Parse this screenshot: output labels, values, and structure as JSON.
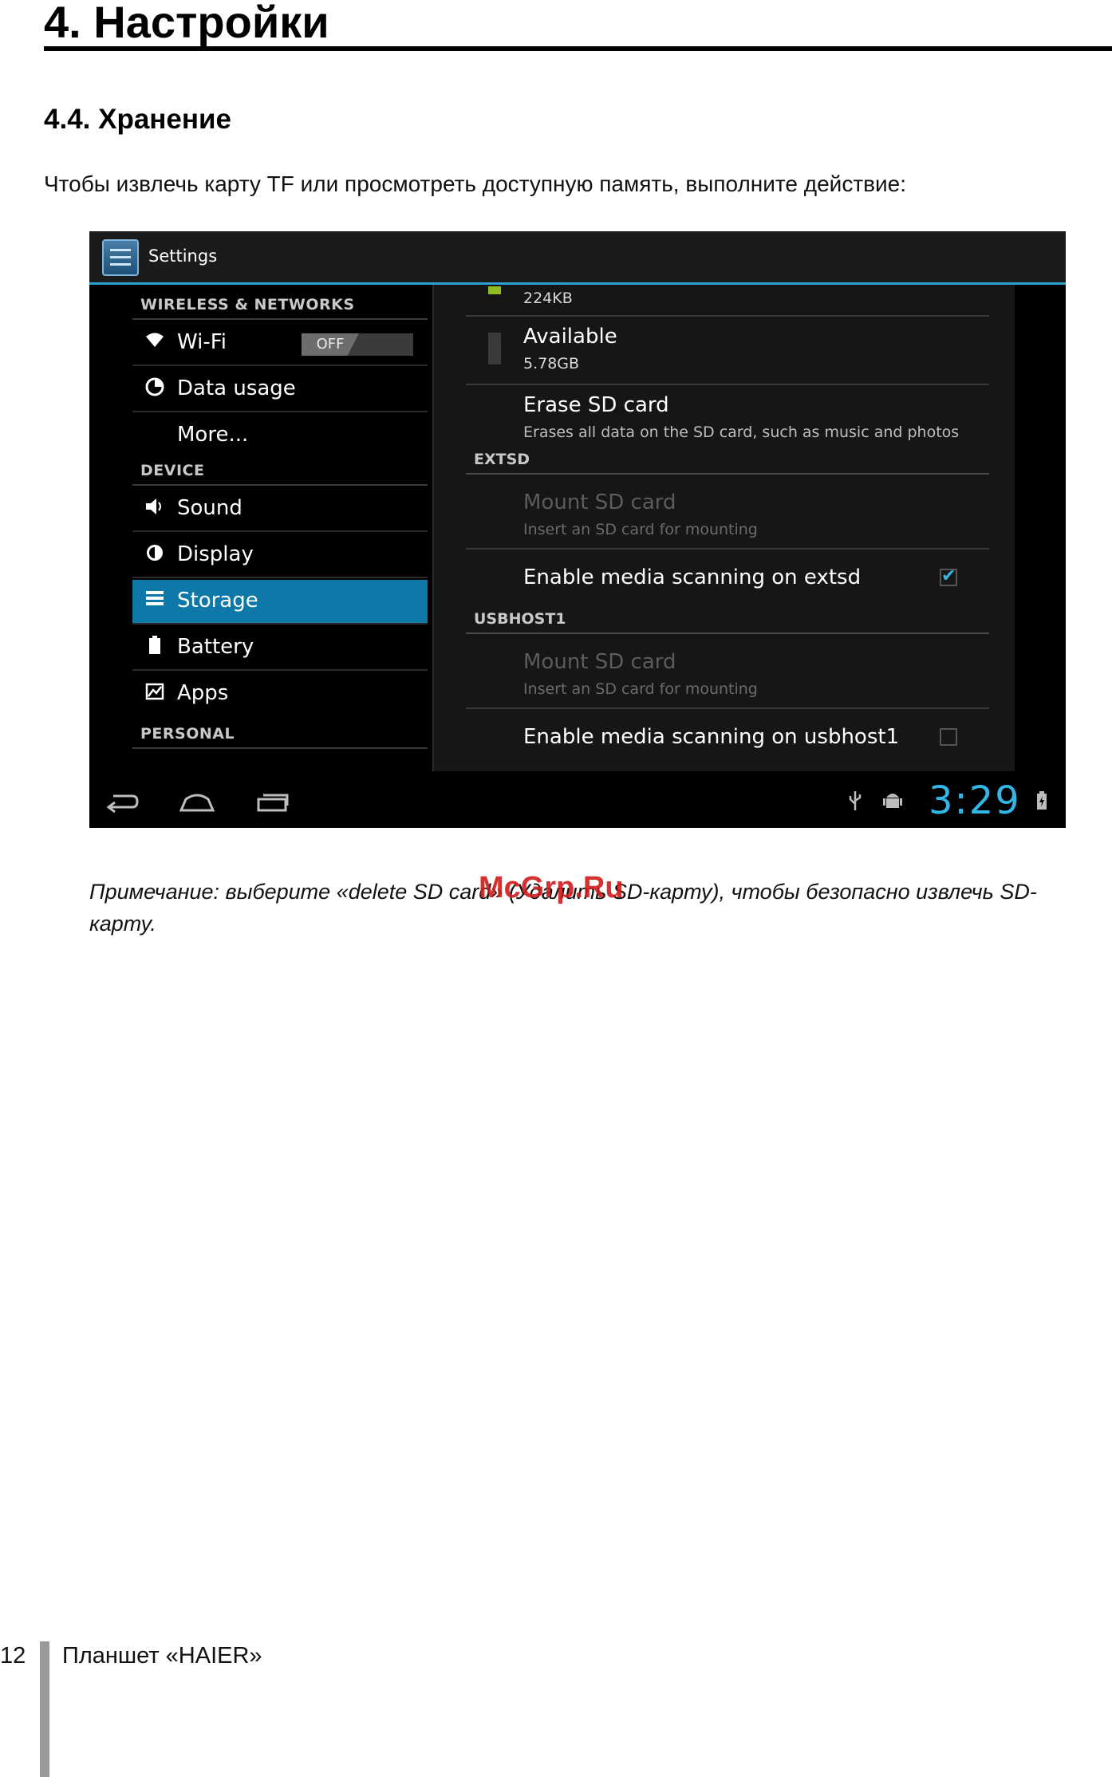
{
  "document": {
    "chapter_title": "4. Настройки",
    "section_title": "4.4. Хранение",
    "intro": "Чтобы извлечь карту TF или просмотреть доступную память, выполните действие:",
    "note": "Примечание:  выберите «delete SD card» (Удалить SD-карту), чтобы безопасно извлечь SD-карту.",
    "watermark": "McGrp.Ru",
    "page_number": "12",
    "footer_title": "Планшет «HAIER»"
  },
  "screenshot": {
    "app_title": "Settings",
    "sidebar": {
      "headers": [
        "WIRELESS & NETWORKS",
        "DEVICE",
        "PERSONAL"
      ],
      "items": [
        {
          "label": "Wi-Fi",
          "icon": "wifi-icon",
          "toggle": "OFF"
        },
        {
          "label": "Data usage",
          "icon": "data-usage-icon"
        },
        {
          "label": "More...",
          "icon": ""
        },
        {
          "label": "Sound",
          "icon": "speaker-icon"
        },
        {
          "label": "Display",
          "icon": "display-icon"
        },
        {
          "label": "Storage",
          "icon": "storage-icon",
          "active": true
        },
        {
          "label": "Battery",
          "icon": "battery-icon"
        },
        {
          "label": "Apps",
          "icon": "apps-icon"
        }
      ]
    },
    "panel": {
      "misc_size": "224KB",
      "available": {
        "title": "Available",
        "value": "5.78GB"
      },
      "erase": {
        "title": "Erase SD card",
        "subtitle": "Erases all data on the SD card, such as music and photos"
      },
      "extsd_header": "EXTSD",
      "extsd_mount": {
        "title": "Mount SD card",
        "subtitle": "Insert an SD card for mounting"
      },
      "extsd_scan": {
        "title": "Enable media scanning on extsd",
        "checked": true
      },
      "usbhost_header": "USBHOST1",
      "usbhost_mount": {
        "title": "Mount SD card",
        "subtitle": "Insert an SD card for mounting"
      },
      "usbhost_scan": {
        "title": "Enable media scanning on usbhost1",
        "checked": false
      }
    },
    "status": {
      "time": "3:29"
    },
    "colors": {
      "accent": "#33b5e5",
      "selected": "#0e78a8",
      "misc_swatch": "#8fbc1f"
    }
  }
}
